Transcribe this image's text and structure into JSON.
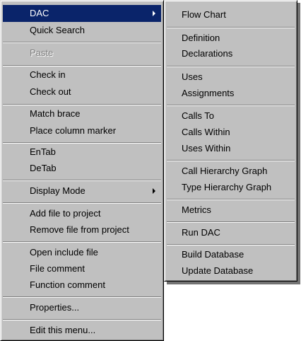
{
  "main_menu": {
    "items": [
      {
        "label": "DAC"
      },
      {
        "label": "Quick Search"
      },
      {
        "label": "Paste"
      },
      {
        "label": "Check in"
      },
      {
        "label": "Check out"
      },
      {
        "label": "Match brace"
      },
      {
        "label": "Place column marker"
      },
      {
        "label": "EnTab"
      },
      {
        "label": "DeTab"
      },
      {
        "label": "Display Mode"
      },
      {
        "label": "Add file to project"
      },
      {
        "label": "Remove file from project"
      },
      {
        "label": "Open include file"
      },
      {
        "label": "File comment"
      },
      {
        "label": "Function comment"
      },
      {
        "label": "Properties..."
      },
      {
        "label": "Edit this menu..."
      }
    ]
  },
  "sub_menu": {
    "items": [
      {
        "label": "Flow Chart"
      },
      {
        "label": "Definition"
      },
      {
        "label": "Declarations"
      },
      {
        "label": "Uses"
      },
      {
        "label": "Assignments"
      },
      {
        "label": "Calls To"
      },
      {
        "label": "Calls Within"
      },
      {
        "label": "Uses Within"
      },
      {
        "label": "Call Hierarchy Graph"
      },
      {
        "label": "Type Hierarchy Graph"
      },
      {
        "label": "Metrics"
      },
      {
        "label": "Run DAC"
      },
      {
        "label": "Build Database"
      },
      {
        "label": "Update Database"
      }
    ]
  },
  "colors": {
    "menu_background": "#c0c0c0",
    "selection": "#0a246a",
    "disabled_text": "#808080"
  },
  "icons": {
    "submenu_arrow": "submenu-arrow-icon"
  }
}
